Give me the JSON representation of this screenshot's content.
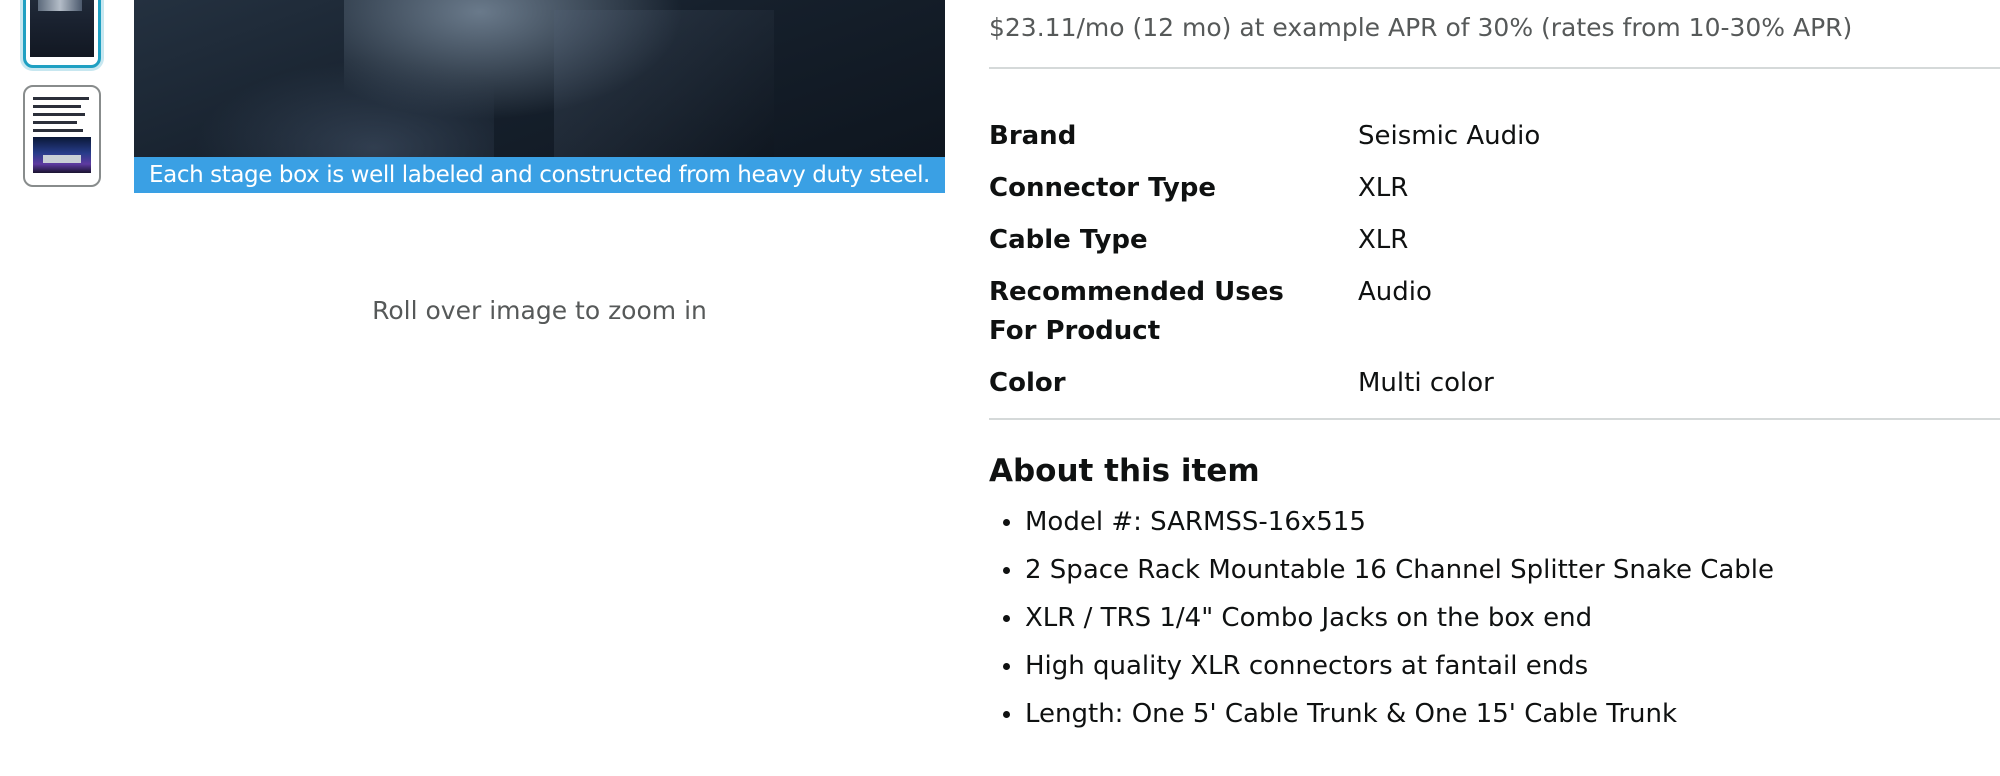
{
  "gallery": {
    "caption": "Each stage box is well labeled and constructed from heavy duty steel.",
    "zoom_hint": "Roll over image to zoom in"
  },
  "financing": {
    "text": "$23.11/mo (12 mo) at example APR of 30% (rates from 10-30% APR)"
  },
  "specs": [
    {
      "key": "Brand",
      "value": "Seismic Audio"
    },
    {
      "key": "Connector Type",
      "value": "XLR"
    },
    {
      "key": "Cable Type",
      "value": "XLR"
    },
    {
      "key": "Recommended Uses For Product",
      "value": "Audio"
    },
    {
      "key": "Color",
      "value": "Multi color"
    }
  ],
  "about": {
    "heading": "About this item",
    "items": [
      "Model #: SARMSS-16x515",
      "2 Space Rack Mountable 16 Channel Splitter Snake Cable",
      "XLR / TRS 1/4\" Combo Jacks on the box end",
      "High quality XLR connectors at fantail ends",
      "Length: One 5' Cable Trunk & One 15' Cable Trunk"
    ]
  },
  "colors": {
    "caption_bar": "#3aa0e4",
    "selected_thumb_border": "#1fa0c2",
    "secondary_text": "#565959",
    "divider": "#d5d9d9"
  }
}
